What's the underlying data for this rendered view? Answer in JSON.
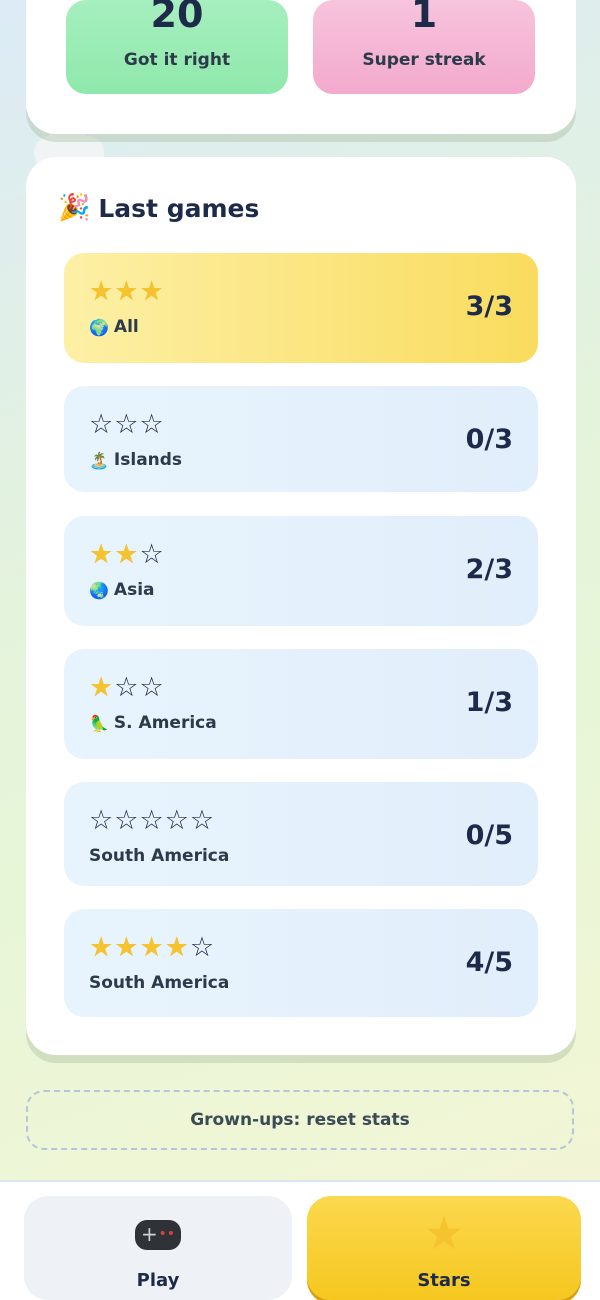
{
  "stats": [
    {
      "value": "20",
      "label": "Got it right"
    },
    {
      "value": "1",
      "label": "Super streak"
    }
  ],
  "last_games": {
    "title": "Last games",
    "title_icon": "party-popper-icon",
    "rows": [
      {
        "stars_filled": 3,
        "stars_total": 3,
        "icon": "🌍",
        "label": "All",
        "score": "3/3",
        "highlight": true
      },
      {
        "stars_filled": 0,
        "stars_total": 3,
        "icon": "🏝️",
        "label": "Islands",
        "score": "0/3",
        "highlight": false
      },
      {
        "stars_filled": 2,
        "stars_total": 3,
        "icon": "🌏",
        "label": "Asia",
        "score": "2/3",
        "highlight": false
      },
      {
        "stars_filled": 1,
        "stars_total": 3,
        "icon": "🦜",
        "label": "S. America",
        "score": "1/3",
        "highlight": false
      },
      {
        "stars_filled": 0,
        "stars_total": 5,
        "icon": "",
        "label": "South America",
        "score": "0/5",
        "highlight": false
      },
      {
        "stars_filled": 4,
        "stars_total": 5,
        "icon": "",
        "label": "South America",
        "score": "4/5",
        "highlight": false
      }
    ]
  },
  "reset_label": "Grown-ups: reset stats",
  "nav": {
    "play_label": "Play",
    "stars_label": "Stars",
    "active": "Stars"
  },
  "colors": {
    "accent_gold": "#f5c71f",
    "tile_green": "#8fe8ab",
    "tile_pink": "#f3a9cd",
    "row_blue": "#e8f4fd",
    "text_dark": "#1d2a4a"
  }
}
